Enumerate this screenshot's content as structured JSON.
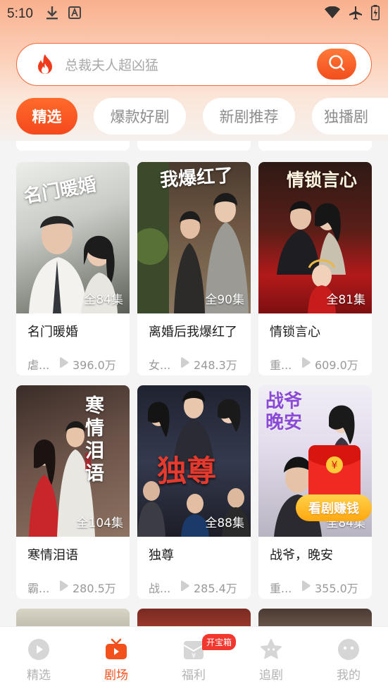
{
  "status_bar": {
    "time": "5:10"
  },
  "search": {
    "placeholder": "总裁夫人超凶猛"
  },
  "tabs": [
    {
      "label": "精选",
      "active": true
    },
    {
      "label": "爆款好剧",
      "active": false
    },
    {
      "label": "新剧推荐",
      "active": false
    },
    {
      "label": "独播剧",
      "active": false
    }
  ],
  "dramas": [
    {
      "title": "名门暖婚",
      "poster_title": "名门暖婚",
      "episodes": "全84集",
      "tag": "虐...",
      "views": "396.0万"
    },
    {
      "title": "离婚后我爆红了",
      "poster_title": "我爆红了",
      "episodes": "全90集",
      "tag": "女...",
      "views": "248.3万"
    },
    {
      "title": "情锁言心",
      "poster_title": "情锁言心",
      "episodes": "全81集",
      "tag": "重...",
      "views": "609.0万"
    },
    {
      "title": "寒情泪语",
      "poster_title": "寒情泪语",
      "episodes": "全104集",
      "tag": "霸...",
      "views": "280.5万"
    },
    {
      "title": "独尊",
      "poster_title": "独尊",
      "episodes": "全88集",
      "tag": "战...",
      "views": "285.4万"
    },
    {
      "title": "战爷，晚安",
      "poster_title": "战爷晚安",
      "episodes": "全84集",
      "tag": "重...",
      "views": "355.0万"
    }
  ],
  "float_reward": {
    "label": "看剧赚钱"
  },
  "bottom_nav": {
    "items": [
      {
        "label": "精选",
        "icon": "play-circle-icon"
      },
      {
        "label": "剧场",
        "icon": "tv-icon",
        "active": true
      },
      {
        "label": "福利",
        "icon": "envelope-icon"
      },
      {
        "label": "追剧",
        "icon": "star-icon"
      },
      {
        "label": "我的",
        "icon": "face-icon"
      }
    ],
    "badge": "开宝箱"
  },
  "colors": {
    "accent": "#f4481d",
    "badge": "#f2372e",
    "reward": "#ffb01f"
  }
}
